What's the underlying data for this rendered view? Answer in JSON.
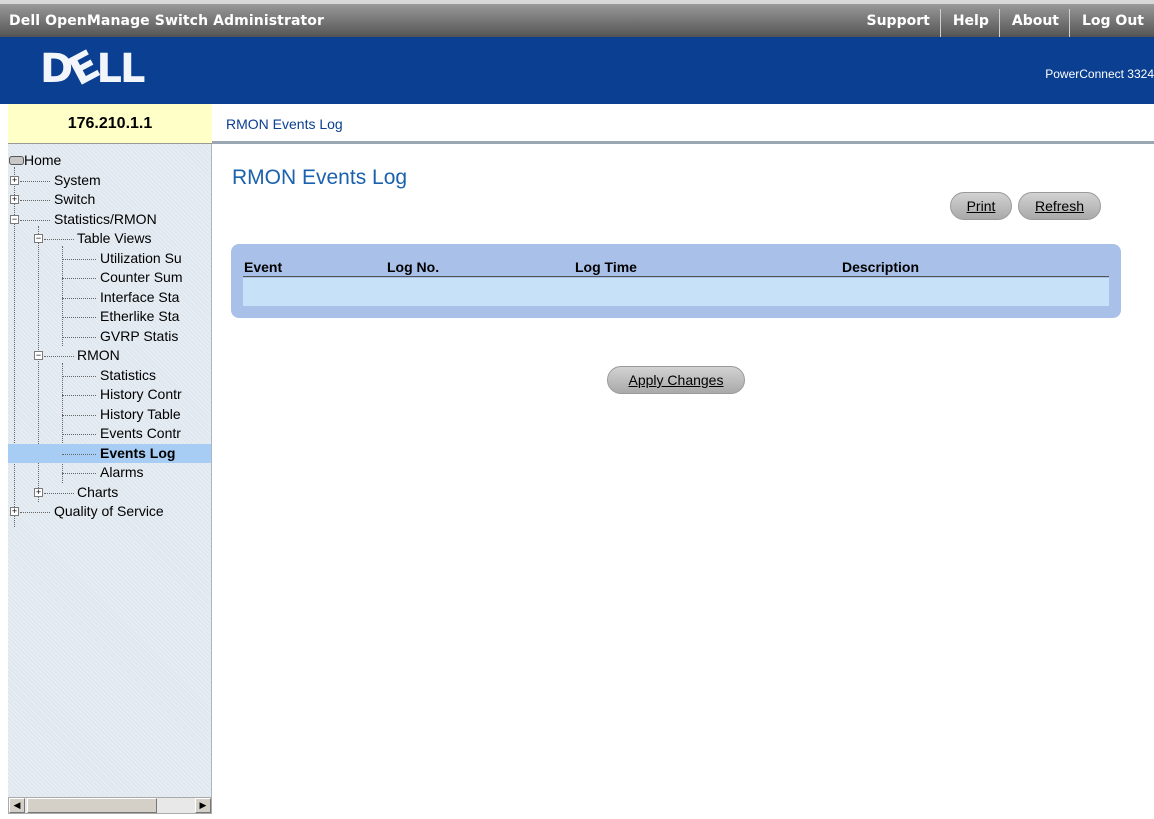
{
  "app": {
    "title": "Dell OpenManage Switch Administrator"
  },
  "toplinks": [
    "Support",
    "Help",
    "About",
    "Log Out"
  ],
  "banner": {
    "logo_text": "DELL",
    "product": "PowerConnect 3324"
  },
  "device": {
    "ip": "176.210.1.1"
  },
  "breadcrumb": "RMON Events Log",
  "tree": {
    "home": "Home",
    "system": "System",
    "switch": "Switch",
    "statistics": "Statistics/RMON",
    "table_views": "Table Views",
    "utilization": "Utilization Su",
    "counter": "Counter Sum",
    "interface": "Interface Sta",
    "etherlike": "Etherlike Sta",
    "gvrp": "GVRP Statis",
    "rmon": "RMON",
    "rmon_statistics": "Statistics",
    "history_control": "History Contr",
    "history_table": "History Table",
    "events_control": "Events Contr",
    "events_log": "Events Log",
    "alarms": "Alarms",
    "charts": "Charts",
    "qos": "Quality of Service"
  },
  "page": {
    "title": "RMON Events Log",
    "print_label": "Print",
    "refresh_label": "Refresh",
    "apply_label": "Apply Changes"
  },
  "table": {
    "columns": [
      "Event",
      "Log No.",
      "Log Time",
      "Description"
    ],
    "rows": []
  },
  "colors": {
    "banner": "#0a3f91",
    "title": "#1a61ae",
    "table_frame": "#a9c0e9",
    "table_row": "#c7e2f8",
    "selected": "#a8cdf4",
    "ip_box": "#ffffc8"
  },
  "icons": [
    "home-icon",
    "expand-icon",
    "collapse-icon",
    "scroll-left-icon",
    "scroll-right-icon"
  ]
}
